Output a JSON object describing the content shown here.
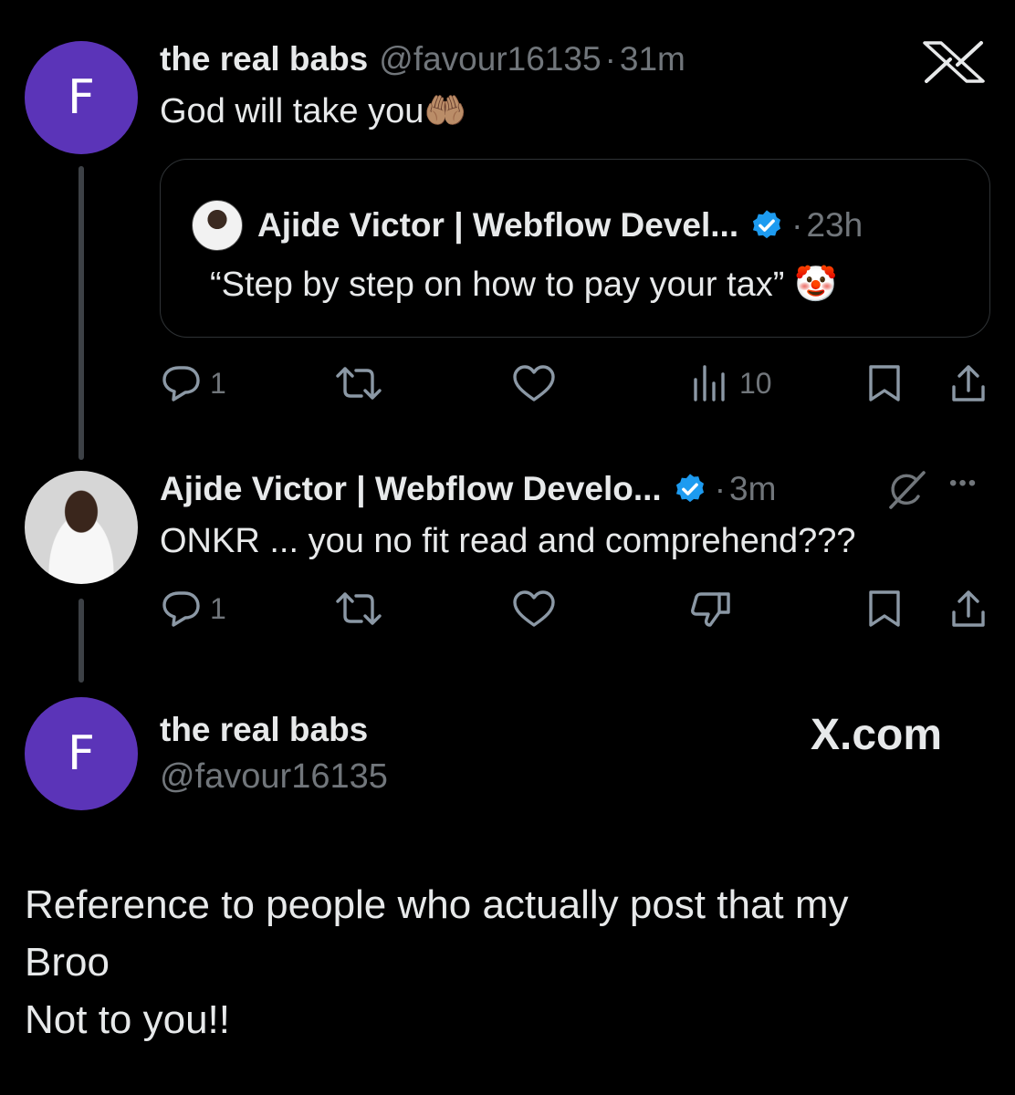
{
  "tweet1": {
    "avatar_letter": "F",
    "name": "the real babs",
    "handle": "@favour16135",
    "dot": "·",
    "time": "31m",
    "text": "God will take you🤲🏽",
    "quote": {
      "name": "Ajide Victor | Webflow Devel...",
      "dot": "·",
      "time": "23h",
      "text": "“Step by step on how to pay your tax” 🤡"
    },
    "actions": {
      "replies": "1",
      "views": "10"
    }
  },
  "tweet2": {
    "name": "Ajide Victor | Webflow Develo...",
    "dot": "·",
    "time": "3m",
    "more": "•••",
    "text": "ONKR ... you no fit read and comprehend???",
    "actions": {
      "replies": "1"
    }
  },
  "profile_card": {
    "avatar_letter": "F",
    "name": "the real babs",
    "handle": "@favour16135",
    "brand": "X.com"
  },
  "reply_text": {
    "line1": "Reference to people who actually post that my",
    "line2": "Broo",
    "line3": "Not to you!!"
  },
  "colors": {
    "background": "#000000",
    "avatar": "#5b34b8",
    "verified": "#1d9bf0",
    "muted": "#71767b"
  },
  "icons": [
    "x-logo-icon",
    "verified-icon",
    "reply-icon",
    "retweet-icon",
    "like-icon",
    "views-icon",
    "bookmark-icon",
    "share-icon",
    "grok-icon",
    "dislike-icon"
  ]
}
